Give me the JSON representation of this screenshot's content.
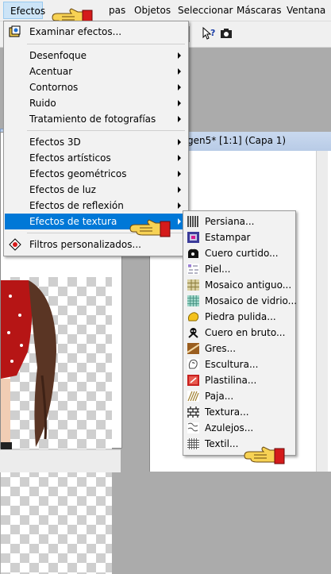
{
  "menubar": {
    "items": [
      {
        "label": "Efectos",
        "id": "efectos"
      },
      {
        "label": "pas",
        "id": "capas"
      },
      {
        "label": "Objetos",
        "id": "objetos"
      },
      {
        "label": "Seleccionar",
        "id": "seleccionar"
      },
      {
        "label": "Máscaras",
        "id": "mascaras"
      },
      {
        "label": "Ventana",
        "id": "ventana"
      }
    ]
  },
  "document": {
    "title": "gen5* [1:1] (Capa 1)"
  },
  "effects_menu": {
    "items": [
      {
        "label": "Examinar efectos...",
        "icon": "browse-effects-icon",
        "submenu": false
      },
      {
        "label": "Desenfoque",
        "submenu": true
      },
      {
        "label": "Acentuar",
        "submenu": true
      },
      {
        "label": "Contornos",
        "submenu": true
      },
      {
        "label": "Ruido",
        "submenu": true
      },
      {
        "label": "Tratamiento de fotografías",
        "submenu": true
      },
      {
        "label": "Efectos 3D",
        "submenu": true
      },
      {
        "label": "Efectos artísticos",
        "submenu": true
      },
      {
        "label": "Efectos geométricos",
        "submenu": true
      },
      {
        "label": "Efectos de luz",
        "submenu": true
      },
      {
        "label": "Efectos de reflexión",
        "submenu": true
      },
      {
        "label": "Efectos de textura",
        "submenu": true,
        "highlighted": true
      },
      {
        "label": "Filtros personalizados...",
        "icon": "custom-filters-icon",
        "submenu": false
      }
    ]
  },
  "texture_submenu": {
    "items": [
      {
        "label": "Persiana...",
        "icon": "blinds-icon"
      },
      {
        "label": "Estampar",
        "icon": "emboss-icon"
      },
      {
        "label": "Cuero curtido...",
        "icon": "fine-leather-icon"
      },
      {
        "label": "Piel...",
        "icon": "fur-icon"
      },
      {
        "label": "Mosaico antiguo...",
        "icon": "antique-mosaic-icon"
      },
      {
        "label": "Mosaico de vidrio...",
        "icon": "glass-mosaic-icon"
      },
      {
        "label": "Piedra pulida...",
        "icon": "polished-stone-icon"
      },
      {
        "label": "Cuero en bruto...",
        "icon": "rough-leather-icon"
      },
      {
        "label": "Gres...",
        "icon": "sandstone-icon"
      },
      {
        "label": "Escultura...",
        "icon": "sculpture-icon"
      },
      {
        "label": "Plastilina...",
        "icon": "soft-plastic-icon"
      },
      {
        "label": "Paja...",
        "icon": "straw-wall-icon"
      },
      {
        "label": "Textura...",
        "icon": "texture-icon"
      },
      {
        "label": "Azulejos...",
        "icon": "tiles-icon"
      },
      {
        "label": "Textil...",
        "icon": "weave-icon"
      }
    ]
  },
  "colors": {
    "highlight": "#0078d7",
    "menu_bg": "#f2f2f2",
    "hand_yellow": "#f7d254",
    "hand_cuff": "#d41b1b"
  }
}
